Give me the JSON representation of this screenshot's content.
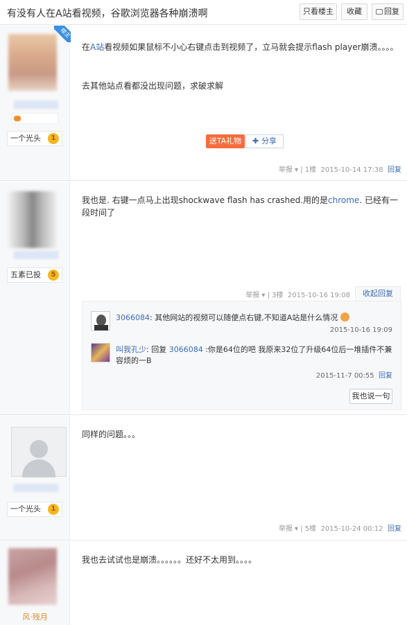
{
  "header": {
    "title": "有没有人在A站看视频，谷歌浏览器各种崩溃啊",
    "only_lz": "只看楼主",
    "collect": "收藏",
    "reply": "回复"
  },
  "posts": [
    {
      "tag": "楼主",
      "badge_name": "一个光头",
      "badge_level": "1",
      "text_link": "A站",
      "text_pre": "在",
      "text_post": "看视频如果鼠标不小心右键点击到视频了，立马就会提示flash player崩溃。。。。",
      "text2": "去其他站点看都没出现问题，求破求解",
      "gift": "送TA礼物",
      "share": "分享",
      "report": "举报",
      "floor": "1楼",
      "time": "2015-10-14 17:38",
      "reply": "回复"
    },
    {
      "badge_name": "五素已投",
      "badge_level": "5",
      "text_pre": "我也是. 右键一点马上出现shockwave flash has crashed.用的是",
      "text_link": "chrome",
      "text_post": ". 已经有一段时间了",
      "report": "举报",
      "floor": "3楼",
      "time": "2015-10-16 19:08",
      "collapse": "收起回复",
      "sub_replies": [
        {
          "user": "3066084",
          "text": ": 其他网站的视频可以随便点右键,不知道A站是什么情况",
          "time": "2015-10-16 19:09"
        },
        {
          "user": "叫我孔少",
          "pre": ": 回复 ",
          "target": "3066084",
          "text": " :你是64位的吧 我原来32位了升级64位后一堆插件不兼容烦的一B",
          "time": "2015-11-7 00:55",
          "reply": "回复"
        }
      ],
      "say": "我也说一句"
    },
    {
      "badge_name": "一个光头",
      "badge_level": "1",
      "text": "同样的问题。。。",
      "report": "举报",
      "floor": "5楼",
      "time": "2015-10-24 00:12",
      "reply": "回复"
    },
    {
      "uname": "风·残月",
      "text": "我也去试试也是崩溃。。。。。。还好不太用到。。。。"
    }
  ],
  "colors": {
    "link": "#3a6bb5",
    "gift": "#f46d3d",
    "level": "#f5b822"
  }
}
